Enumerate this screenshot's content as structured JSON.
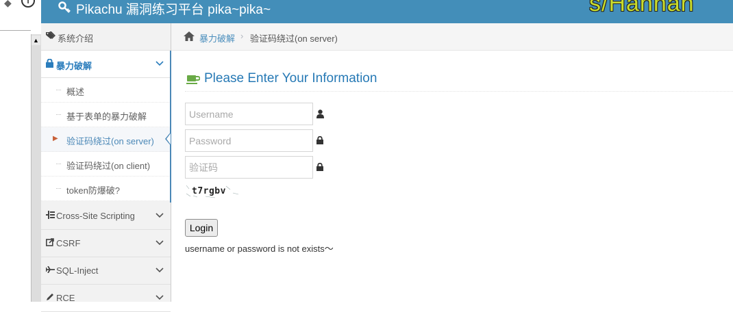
{
  "browser": {
    "scroll_up": "▲"
  },
  "header": {
    "brand": "Pikachu 漏洞练习平台 pika~pika~",
    "watermark": "s/Hanhan"
  },
  "sidebar": {
    "items": [
      {
        "label": "系统介绍",
        "icon": "tag-icon"
      },
      {
        "label": "暴力破解",
        "icon": "lock-icon",
        "active": true
      },
      {
        "label": "Cross-Site Scripting",
        "icon": "list-icon"
      },
      {
        "label": "CSRF",
        "icon": "share-icon"
      },
      {
        "label": "SQL-Inject",
        "icon": "plane-icon"
      },
      {
        "label": "RCE",
        "icon": "pencil-icon"
      }
    ],
    "subitems": [
      {
        "label": "概述"
      },
      {
        "label": "基于表单的暴力破解"
      },
      {
        "label": "验证码绕过(on server)",
        "active": true
      },
      {
        "label": "验证码绕过(on client)"
      },
      {
        "label": "token防爆破?"
      }
    ]
  },
  "breadcrumb": {
    "root": "暴力破解",
    "sep": "›",
    "current": "验证码绕过(on server)"
  },
  "page": {
    "title": "Please Enter Your Information"
  },
  "form": {
    "username_placeholder": "Username",
    "password_placeholder": "Password",
    "captcha_placeholder": "验证码",
    "captcha_text": "t7rgbv",
    "login_label": "Login",
    "message": "username or password is not exists～"
  },
  "colors": {
    "navbar": "#438eb9",
    "link": "#4c8fbd",
    "title": "#2679b5",
    "accent_caret": "#c86139"
  }
}
